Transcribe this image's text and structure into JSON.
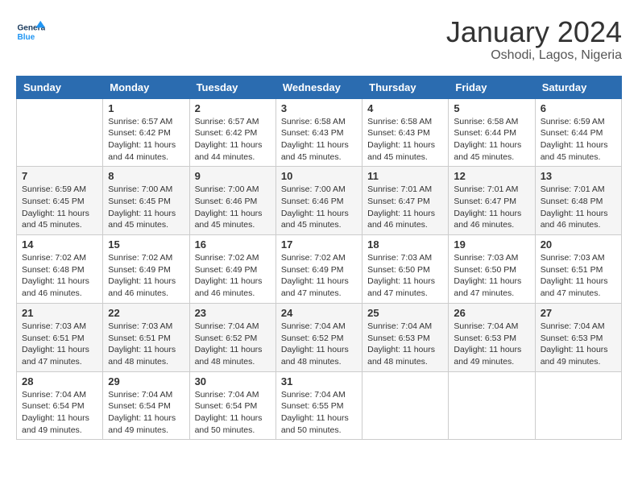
{
  "header": {
    "logo_general": "General",
    "logo_blue": "Blue",
    "title": "January 2024",
    "subtitle": "Oshodi, Lagos, Nigeria"
  },
  "calendar": {
    "days_of_week": [
      "Sunday",
      "Monday",
      "Tuesday",
      "Wednesday",
      "Thursday",
      "Friday",
      "Saturday"
    ],
    "weeks": [
      [
        {
          "day": "",
          "sunrise": "",
          "sunset": "",
          "daylight": ""
        },
        {
          "day": "1",
          "sunrise": "Sunrise: 6:57 AM",
          "sunset": "Sunset: 6:42 PM",
          "daylight": "Daylight: 11 hours and 44 minutes."
        },
        {
          "day": "2",
          "sunrise": "Sunrise: 6:57 AM",
          "sunset": "Sunset: 6:42 PM",
          "daylight": "Daylight: 11 hours and 44 minutes."
        },
        {
          "day": "3",
          "sunrise": "Sunrise: 6:58 AM",
          "sunset": "Sunset: 6:43 PM",
          "daylight": "Daylight: 11 hours and 45 minutes."
        },
        {
          "day": "4",
          "sunrise": "Sunrise: 6:58 AM",
          "sunset": "Sunset: 6:43 PM",
          "daylight": "Daylight: 11 hours and 45 minutes."
        },
        {
          "day": "5",
          "sunrise": "Sunrise: 6:58 AM",
          "sunset": "Sunset: 6:44 PM",
          "daylight": "Daylight: 11 hours and 45 minutes."
        },
        {
          "day": "6",
          "sunrise": "Sunrise: 6:59 AM",
          "sunset": "Sunset: 6:44 PM",
          "daylight": "Daylight: 11 hours and 45 minutes."
        }
      ],
      [
        {
          "day": "7",
          "sunrise": "Sunrise: 6:59 AM",
          "sunset": "Sunset: 6:45 PM",
          "daylight": "Daylight: 11 hours and 45 minutes."
        },
        {
          "day": "8",
          "sunrise": "Sunrise: 7:00 AM",
          "sunset": "Sunset: 6:45 PM",
          "daylight": "Daylight: 11 hours and 45 minutes."
        },
        {
          "day": "9",
          "sunrise": "Sunrise: 7:00 AM",
          "sunset": "Sunset: 6:46 PM",
          "daylight": "Daylight: 11 hours and 45 minutes."
        },
        {
          "day": "10",
          "sunrise": "Sunrise: 7:00 AM",
          "sunset": "Sunset: 6:46 PM",
          "daylight": "Daylight: 11 hours and 45 minutes."
        },
        {
          "day": "11",
          "sunrise": "Sunrise: 7:01 AM",
          "sunset": "Sunset: 6:47 PM",
          "daylight": "Daylight: 11 hours and 46 minutes."
        },
        {
          "day": "12",
          "sunrise": "Sunrise: 7:01 AM",
          "sunset": "Sunset: 6:47 PM",
          "daylight": "Daylight: 11 hours and 46 minutes."
        },
        {
          "day": "13",
          "sunrise": "Sunrise: 7:01 AM",
          "sunset": "Sunset: 6:48 PM",
          "daylight": "Daylight: 11 hours and 46 minutes."
        }
      ],
      [
        {
          "day": "14",
          "sunrise": "Sunrise: 7:02 AM",
          "sunset": "Sunset: 6:48 PM",
          "daylight": "Daylight: 11 hours and 46 minutes."
        },
        {
          "day": "15",
          "sunrise": "Sunrise: 7:02 AM",
          "sunset": "Sunset: 6:49 PM",
          "daylight": "Daylight: 11 hours and 46 minutes."
        },
        {
          "day": "16",
          "sunrise": "Sunrise: 7:02 AM",
          "sunset": "Sunset: 6:49 PM",
          "daylight": "Daylight: 11 hours and 46 minutes."
        },
        {
          "day": "17",
          "sunrise": "Sunrise: 7:02 AM",
          "sunset": "Sunset: 6:49 PM",
          "daylight": "Daylight: 11 hours and 47 minutes."
        },
        {
          "day": "18",
          "sunrise": "Sunrise: 7:03 AM",
          "sunset": "Sunset: 6:50 PM",
          "daylight": "Daylight: 11 hours and 47 minutes."
        },
        {
          "day": "19",
          "sunrise": "Sunrise: 7:03 AM",
          "sunset": "Sunset: 6:50 PM",
          "daylight": "Daylight: 11 hours and 47 minutes."
        },
        {
          "day": "20",
          "sunrise": "Sunrise: 7:03 AM",
          "sunset": "Sunset: 6:51 PM",
          "daylight": "Daylight: 11 hours and 47 minutes."
        }
      ],
      [
        {
          "day": "21",
          "sunrise": "Sunrise: 7:03 AM",
          "sunset": "Sunset: 6:51 PM",
          "daylight": "Daylight: 11 hours and 47 minutes."
        },
        {
          "day": "22",
          "sunrise": "Sunrise: 7:03 AM",
          "sunset": "Sunset: 6:51 PM",
          "daylight": "Daylight: 11 hours and 48 minutes."
        },
        {
          "day": "23",
          "sunrise": "Sunrise: 7:04 AM",
          "sunset": "Sunset: 6:52 PM",
          "daylight": "Daylight: 11 hours and 48 minutes."
        },
        {
          "day": "24",
          "sunrise": "Sunrise: 7:04 AM",
          "sunset": "Sunset: 6:52 PM",
          "daylight": "Daylight: 11 hours and 48 minutes."
        },
        {
          "day": "25",
          "sunrise": "Sunrise: 7:04 AM",
          "sunset": "Sunset: 6:53 PM",
          "daylight": "Daylight: 11 hours and 48 minutes."
        },
        {
          "day": "26",
          "sunrise": "Sunrise: 7:04 AM",
          "sunset": "Sunset: 6:53 PM",
          "daylight": "Daylight: 11 hours and 49 minutes."
        },
        {
          "day": "27",
          "sunrise": "Sunrise: 7:04 AM",
          "sunset": "Sunset: 6:53 PM",
          "daylight": "Daylight: 11 hours and 49 minutes."
        }
      ],
      [
        {
          "day": "28",
          "sunrise": "Sunrise: 7:04 AM",
          "sunset": "Sunset: 6:54 PM",
          "daylight": "Daylight: 11 hours and 49 minutes."
        },
        {
          "day": "29",
          "sunrise": "Sunrise: 7:04 AM",
          "sunset": "Sunset: 6:54 PM",
          "daylight": "Daylight: 11 hours and 49 minutes."
        },
        {
          "day": "30",
          "sunrise": "Sunrise: 7:04 AM",
          "sunset": "Sunset: 6:54 PM",
          "daylight": "Daylight: 11 hours and 50 minutes."
        },
        {
          "day": "31",
          "sunrise": "Sunrise: 7:04 AM",
          "sunset": "Sunset: 6:55 PM",
          "daylight": "Daylight: 11 hours and 50 minutes."
        },
        {
          "day": "",
          "sunrise": "",
          "sunset": "",
          "daylight": ""
        },
        {
          "day": "",
          "sunrise": "",
          "sunset": "",
          "daylight": ""
        },
        {
          "day": "",
          "sunrise": "",
          "sunset": "",
          "daylight": ""
        }
      ]
    ]
  }
}
